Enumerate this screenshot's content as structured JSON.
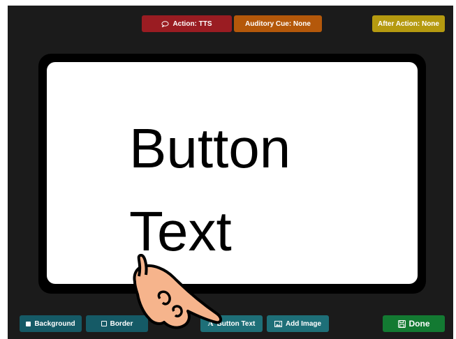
{
  "top_bar": {
    "action_label": "Action: TTS",
    "auditory_cue_label": "Auditory Cue: None",
    "after_action_label": "After Action: None"
  },
  "card": {
    "button_text": "Button Text"
  },
  "bottom_bar": {
    "background_label": "Background",
    "border_label": "Border",
    "button_text_label": "Button Text",
    "button_text_icon_glyph": "A",
    "add_image_label": "Add Image",
    "done_label": "Done"
  },
  "icons": {
    "action": "speech-bubble-icon",
    "background": "filled-square-icon",
    "border": "outline-square-icon",
    "button_text": "letter-a-icon",
    "add_image": "image-icon",
    "done": "save-disk-icon",
    "pointer": "pointing-hand-icon"
  },
  "colors": {
    "panel_background": "#1b1b1b",
    "action": "#9a1c22",
    "auditory_cue": "#b4580a",
    "after_action": "#b59a10",
    "teal": "#155a66",
    "done": "#137a32",
    "hand_fill": "#f6b48c"
  }
}
